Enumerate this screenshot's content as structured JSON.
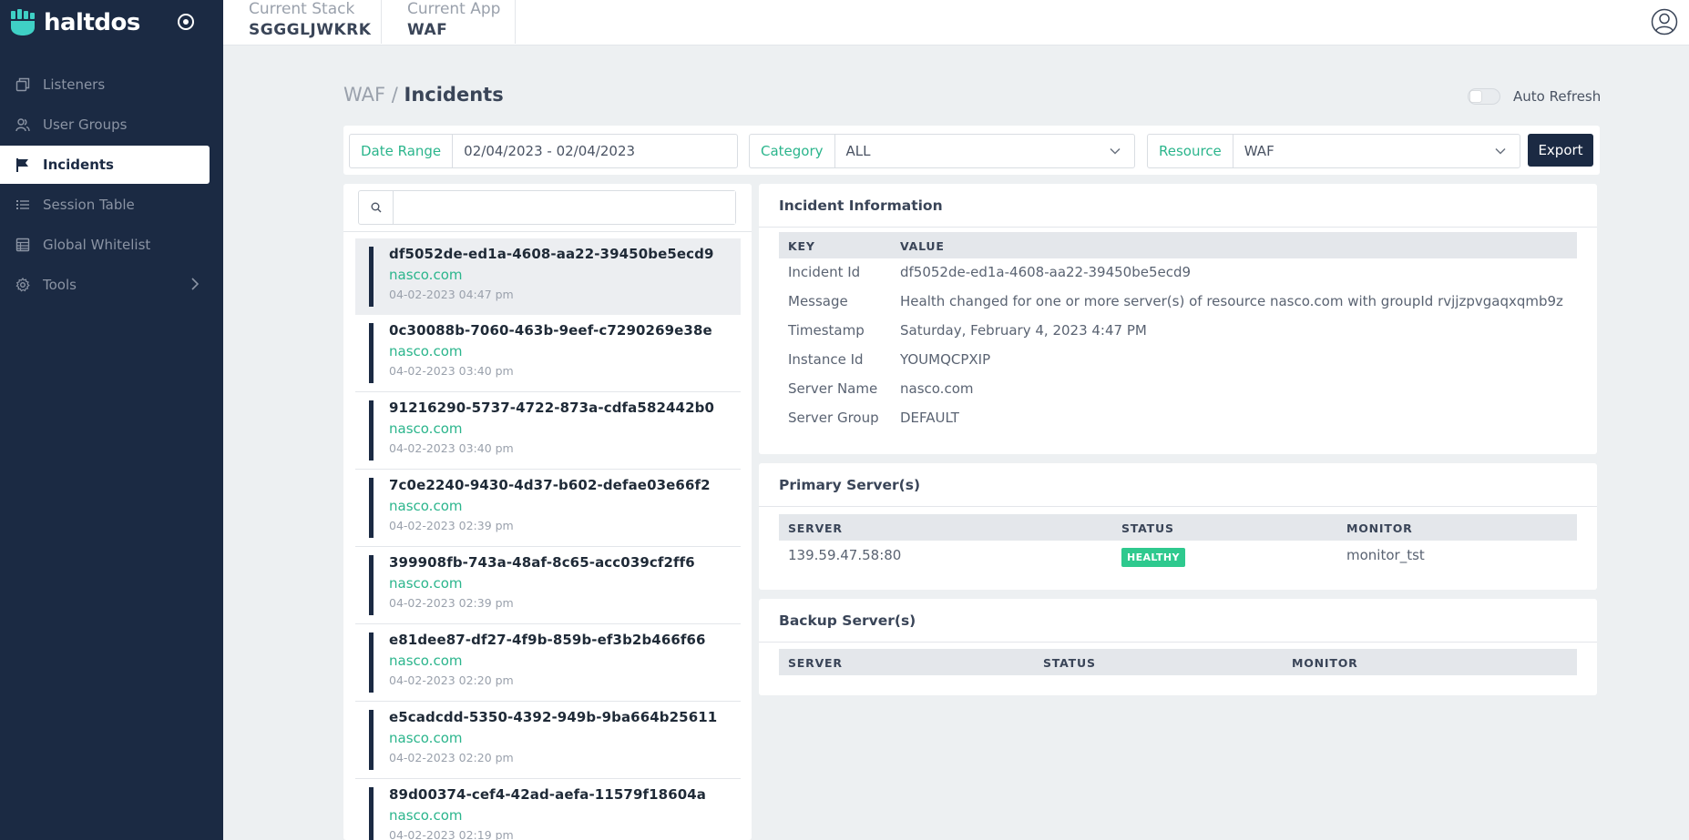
{
  "brand": {
    "name": "haltdos"
  },
  "sidebar": {
    "items": [
      {
        "label": "Listeners",
        "icon": "window-icon",
        "active": false
      },
      {
        "label": "User Groups",
        "icon": "users-icon",
        "active": false
      },
      {
        "label": "Incidents",
        "icon": "flag-icon",
        "active": true
      },
      {
        "label": "Session Table",
        "icon": "list-icon",
        "active": false
      },
      {
        "label": "Global Whitelist",
        "icon": "table-icon",
        "active": false
      },
      {
        "label": "Tools",
        "icon": "gear-icon",
        "active": false
      }
    ]
  },
  "topbar": {
    "stack_label": "Current Stack",
    "stack_value": "SGGGLJWKRK",
    "app_label": "Current App",
    "app_value": "WAF"
  },
  "page": {
    "breadcrumb_parent": "WAF",
    "breadcrumb_sep": "/",
    "title": "Incidents",
    "auto_refresh_label": "Auto Refresh"
  },
  "filters": {
    "date_label": "Date Range",
    "date_value": "02/04/2023 - 02/04/2023",
    "category_label": "Category",
    "category_value": "ALL",
    "resource_label": "Resource",
    "resource_value": "WAF",
    "export_label": "Export"
  },
  "search": {
    "placeholder": ""
  },
  "incidents": [
    {
      "id": "df5052de-ed1a-4608-aa22-39450be5ecd9",
      "host": "nasco.com",
      "time": "04-02-2023 04:47 pm"
    },
    {
      "id": "0c30088b-7060-463b-9eef-c7290269e38e",
      "host": "nasco.com",
      "time": "04-02-2023 03:40 pm"
    },
    {
      "id": "91216290-5737-4722-873a-cdfa582442b0",
      "host": "nasco.com",
      "time": "04-02-2023 03:40 pm"
    },
    {
      "id": "7c0e2240-9430-4d37-b602-defae03e66f2",
      "host": "nasco.com",
      "time": "04-02-2023 02:39 pm"
    },
    {
      "id": "399908fb-743a-48af-8c65-acc039cf2ff6",
      "host": "nasco.com",
      "time": "04-02-2023 02:39 pm"
    },
    {
      "id": "e81dee87-df27-4f9b-859b-ef3b2b466f66",
      "host": "nasco.com",
      "time": "04-02-2023 02:20 pm"
    },
    {
      "id": "e5cadcdd-5350-4392-949b-9ba664b25611",
      "host": "nasco.com",
      "time": "04-02-2023 02:20 pm"
    },
    {
      "id": "89d00374-cef4-42ad-aefa-11579f18604a",
      "host": "nasco.com",
      "time": "04-02-2023 02:19 pm"
    }
  ],
  "incident_info": {
    "title": "Incident Information",
    "col_key": "KEY",
    "col_value": "VALUE",
    "rows": [
      {
        "key": "Incident Id",
        "value": "df5052de-ed1a-4608-aa22-39450be5ecd9"
      },
      {
        "key": "Message",
        "value": "Health changed for one or more server(s) of resource nasco.com with groupId rvjjzpvgaqxqmb9z"
      },
      {
        "key": "Timestamp",
        "value": "Saturday, February 4, 2023 4:47 PM"
      },
      {
        "key": "Instance Id",
        "value": "YOUMQCPXIP"
      },
      {
        "key": "Server Name",
        "value": "nasco.com"
      },
      {
        "key": "Server Group",
        "value": "DEFAULT"
      }
    ]
  },
  "primary_servers": {
    "title": "Primary Server(s)",
    "col_server": "SERVER",
    "col_status": "STATUS",
    "col_monitor": "MONITOR",
    "rows": [
      {
        "server": "139.59.47.58:80",
        "status": "HEALTHY",
        "monitor": "monitor_tst"
      }
    ]
  },
  "backup_servers": {
    "title": "Backup Server(s)",
    "col_server": "SERVER",
    "col_status": "STATUS",
    "col_monitor": "MONITOR"
  },
  "colors": {
    "sidebar_bg": "#1b2a43",
    "accent_green": "#2bb58c",
    "healthy_badge": "#2ec98e"
  }
}
